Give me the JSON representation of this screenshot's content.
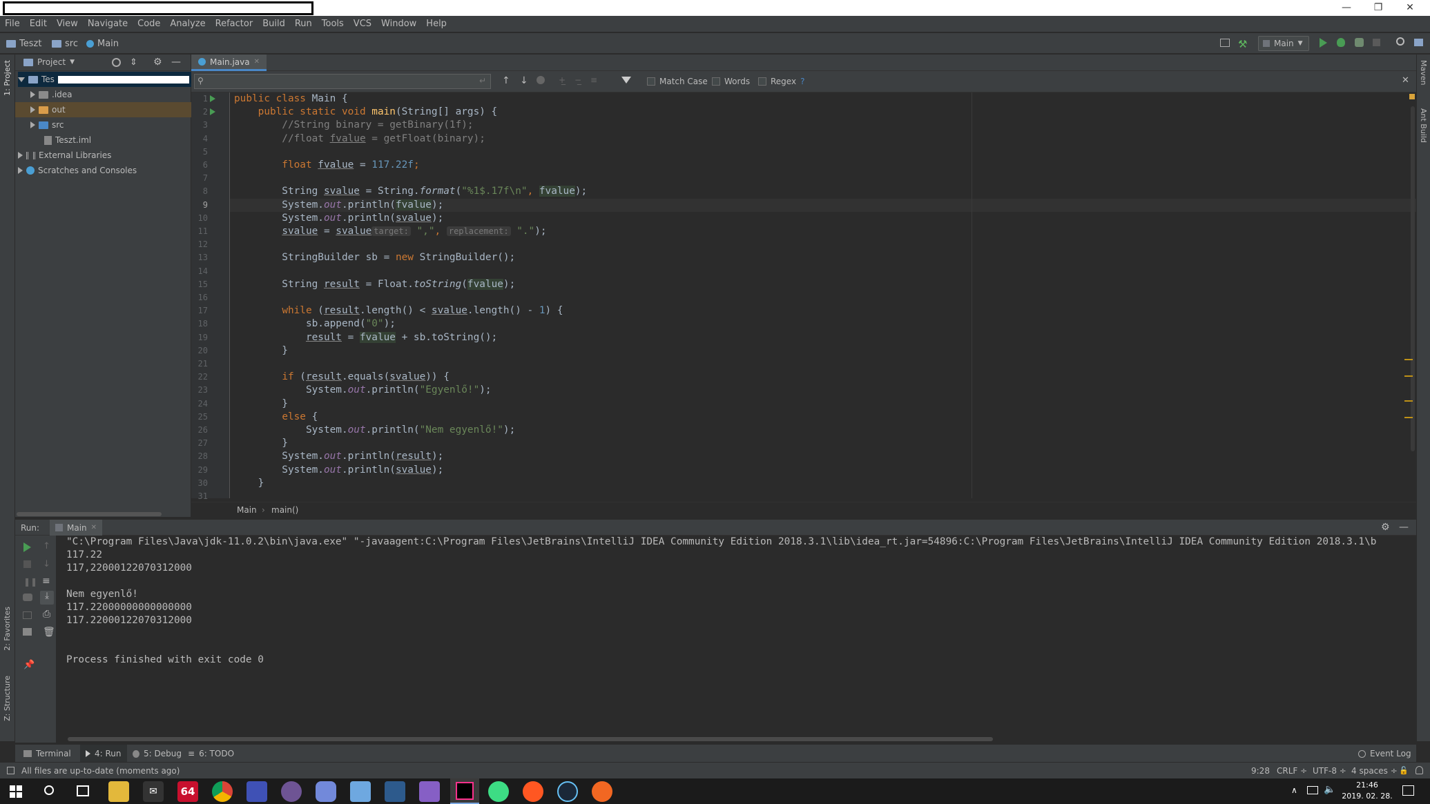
{
  "window": {
    "minimize": "—",
    "restore": "❐",
    "close": "✕"
  },
  "menu": [
    "File",
    "Edit",
    "View",
    "Navigate",
    "Code",
    "Analyze",
    "Refactor",
    "Build",
    "Run",
    "Tools",
    "VCS",
    "Window",
    "Help"
  ],
  "nav": {
    "project": "Teszt",
    "src": "src",
    "main": "Main",
    "run_config": "Main"
  },
  "project_panel": {
    "title": "Project",
    "root": "Tes",
    "items": [
      ".idea",
      "out",
      "src",
      "Teszt.iml"
    ],
    "external": "External Libraries",
    "scratches": "Scratches and Consoles"
  },
  "left_strip": {
    "project": "1: Project",
    "favorites": "2: Favorites",
    "structure": "Z: Structure"
  },
  "right_strip": {
    "maven": "Maven",
    "ant": "Ant Build"
  },
  "editor": {
    "tab": "Main.java",
    "find": {
      "match_case": "Match Case",
      "words": "Words",
      "regex": "Regex",
      "help": "?"
    },
    "lines": [
      "1",
      "2",
      "3",
      "4",
      "5",
      "6",
      "7",
      "8",
      "9",
      "10",
      "11",
      "12",
      "13",
      "14",
      "15",
      "16",
      "17",
      "18",
      "19",
      "20",
      "21",
      "22",
      "23",
      "24",
      "25",
      "26",
      "27",
      "28",
      "29",
      "30",
      "31"
    ],
    "code": {
      "l1a": "public class ",
      "l1b": "Main {",
      "l2a": "    public static void ",
      "l2b": "main",
      "l2c": "(String[] args) {",
      "l3": "        //String binary = getBinary(1f);",
      "l4a": "        //float ",
      "l4b": "fvalue",
      "l4c": " = getFloat(binary);",
      "l6a": "        float ",
      "l6b": "fvalue",
      "l6c": " = ",
      "l6d": "117.22f",
      ";": ";",
      "l8a": "        String ",
      "l8b": "svalue",
      "l8c": " = String.",
      "l8d": "format",
      "l8e": "(",
      "l8f": "\"%1$.17f\\n\"",
      "l8g": ", ",
      "l8h": "fvalue",
      "l8i": ");",
      "l9a": "        System.",
      "out": "out",
      "l9b": ".println(",
      "l9c": "fvalue",
      "l9d": ");",
      "l10c": "svalue",
      "l11a": "        ",
      "l11b": "svalue",
      "l11c": " = ",
      "l11d": "svalue",
      ".replace(": ".replace( ",
      "hint1": "target:",
      "l11e": " \",\"",
      "l11f": ", ",
      "hint2": "replacement:",
      "l11g": " \".\"",
      "l11h": ");",
      "l13a": "        StringBuilder sb = ",
      "new": "new",
      "l13b": " StringBuilder();",
      "l15a": "        String ",
      "l15b": "result",
      "l15c": " = Float.",
      "l15d": "toString",
      "l15e": "(",
      "l15f": "fvalue",
      "l15g": ");",
      "l17a": "        ",
      "while": "while",
      " (": " (",
      "result": "result",
      "l17b": ".length() < ",
      "l17c": "svalue",
      "l17d": ".length() - ",
      "one": "1",
      ") {": ") {",
      "l18a": "            sb.append(",
      "zero": "\"0\"",
      "l18b": ");",
      "l19a": "            ",
      "l19b": " = ",
      "l19c": " + sb.toString();",
      "brace": "        }",
      "if": "if",
      "l22b": ".equals(",
      "l22c": ")) {",
      "l23a": "            System.",
      "l23s": "\"Egyenlő!\"",
      "else": "else",
      "l25b": " {",
      "l26s": "\"Nem egyenlő!\"",
      "l28b": ".println(",
      "l30": "    }"
    },
    "breadcrumb": {
      "a": "Main",
      "sep": "›",
      "b": "main()"
    }
  },
  "run": {
    "label": "Run:",
    "tab": "Main",
    "console": [
      "\"C:\\Program Files\\Java\\jdk-11.0.2\\bin\\java.exe\" \"-javaagent:C:\\Program Files\\JetBrains\\IntelliJ IDEA Community Edition 2018.3.1\\lib\\idea_rt.jar=54896:C:\\Program Files\\JetBrains\\IntelliJ IDEA Community Edition 2018.3.1\\b",
      "117.22",
      "117,22000122070312000",
      "",
      "Nem egyenlő!",
      "117.22000000000000000",
      "117.22000122070312000",
      "",
      "",
      "Process finished with exit code 0"
    ]
  },
  "tool_windows": {
    "terminal": "Terminal",
    "run": "4: Run",
    "debug": "5: Debug",
    "todo": "6: TODO",
    "event_log": "Event Log"
  },
  "status": {
    "message": "All files are up-to-date (moments ago)",
    "pos": "9:28",
    "crlf": "CRLF ÷",
    "enc": "UTF-8 ÷",
    "indent": "4 spaces ÷"
  },
  "taskbar": {
    "time": "21:46",
    "date": "2019. 02. 28.",
    "badge64": "64"
  },
  "colors": {
    "bg": "#2b2b2b",
    "panel": "#3c3f41",
    "keyword": "#cc7832",
    "string": "#6a8759",
    "comment": "#808080",
    "method": "#ffc66d",
    "number": "#6897bb",
    "static_field": "#9876aa",
    "run_green": "#499c54"
  }
}
